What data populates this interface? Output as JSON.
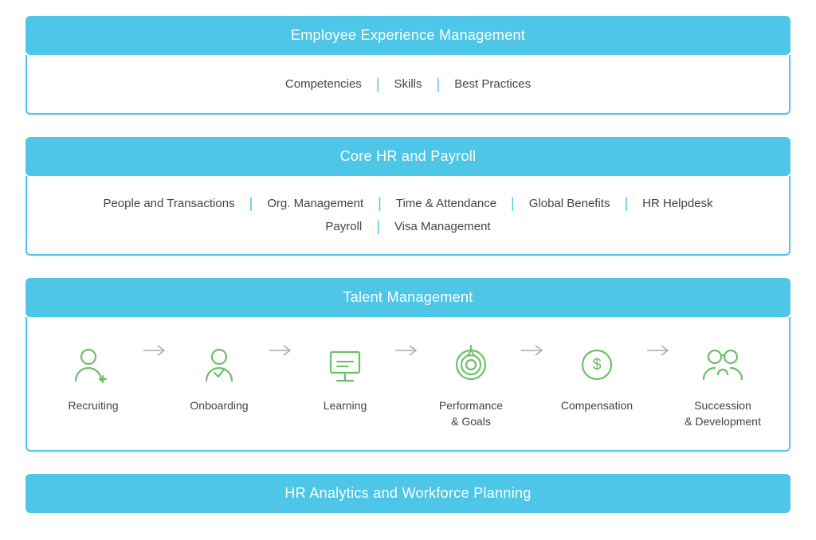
{
  "sections": {
    "employee_experience": {
      "header": "Employee Experience Management",
      "items": [
        "Competencies",
        "Skills",
        "Best Practices"
      ]
    },
    "core_hr": {
      "header": "Core HR and Payroll",
      "row1": [
        "People and Transactions",
        "Org. Management",
        "Time & Attendance",
        "Global Benefits",
        "HR Helpdesk"
      ],
      "row2": [
        "Payroll",
        "Visa Management"
      ]
    },
    "talent_management": {
      "header": "Talent Management",
      "items": [
        {
          "label": "Recruiting",
          "icon": "recruiting"
        },
        {
          "label": "Onboarding",
          "icon": "onboarding"
        },
        {
          "label": "Learning",
          "icon": "learning"
        },
        {
          "label": "Performance\n& Goals",
          "icon": "performance"
        },
        {
          "label": "Compensation",
          "icon": "compensation"
        },
        {
          "label": "Succession\n& Development",
          "icon": "succession"
        }
      ]
    },
    "hr_analytics": {
      "header": "HR Analytics and Workforce Planning"
    }
  },
  "separator": "|",
  "colors": {
    "accent": "#4dc6e8",
    "text": "#444444",
    "icon_stroke": "#6dbf67"
  }
}
